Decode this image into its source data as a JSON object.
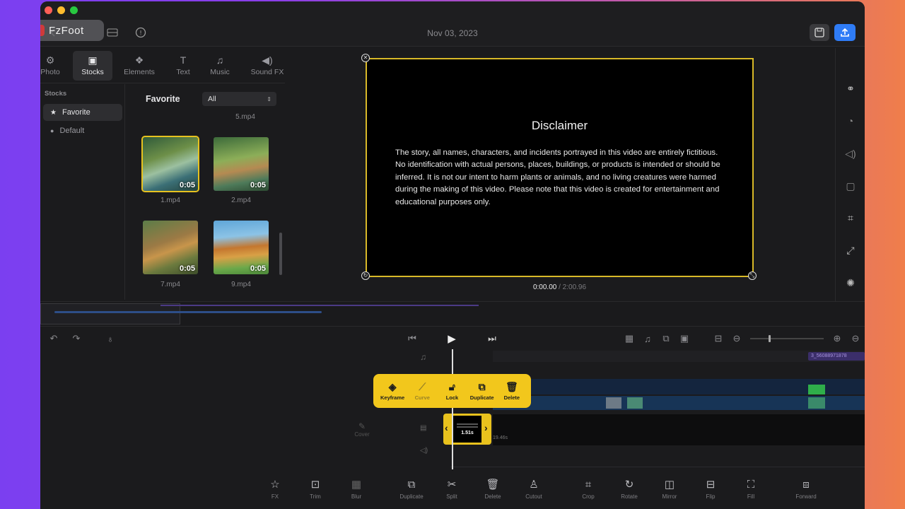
{
  "watermark": "FzFoot",
  "titlebar": {
    "date": "Nov 03, 2023"
  },
  "tabs": [
    {
      "label": "Photo",
      "icon": "photo-icon"
    },
    {
      "label": "Stocks",
      "icon": "stocks-icon"
    },
    {
      "label": "Elements",
      "icon": "elements-icon"
    },
    {
      "label": "Text",
      "icon": "text-icon"
    },
    {
      "label": "Music",
      "icon": "music-icon"
    },
    {
      "label": "Sound FX",
      "icon": "sound-fx-icon"
    }
  ],
  "sidebar": {
    "heading": "Stocks",
    "items": [
      {
        "label": "Favorite",
        "active": true
      },
      {
        "label": "Default",
        "active": false
      }
    ]
  },
  "library": {
    "title": "Favorite",
    "filter_value": "All",
    "top_caption": "5.mp4",
    "items": [
      {
        "name": "1.mp4",
        "duration": "0:05",
        "selected": true
      },
      {
        "name": "2.mp4",
        "duration": "0:05",
        "selected": false
      },
      {
        "name": "7.mp4",
        "duration": "0:05",
        "selected": false
      },
      {
        "name": "9.mp4",
        "duration": "0:05",
        "selected": false
      }
    ]
  },
  "preview": {
    "title": "Disclaimer",
    "body": "The story, all names, characters, and incidents portrayed in this video are entirely fictitious. No identification with actual persons, places, buildings, or products is intended or should be inferred. It is not our intent to harm plants or animals, and no living creatures were harmed during the making of this video. Please note that this video is created for entertainment and educational purposes only.",
    "time_current": "0:00.00",
    "time_total": " / 2:00.96"
  },
  "timeline": {
    "audio_clip_label": "3_56088971878",
    "selected_clip_duration": "1.51s",
    "clip_label": "19.46s",
    "cover_label": "Cover"
  },
  "context_menu": [
    {
      "label": "Keyframe",
      "icon": "keyframe-icon",
      "enabled": true
    },
    {
      "label": "Curve",
      "icon": "curve-icon",
      "enabled": false
    },
    {
      "label": "Lock",
      "icon": "lock-icon",
      "enabled": true
    },
    {
      "label": "Duplicate",
      "icon": "duplicate-icon",
      "enabled": true
    },
    {
      "label": "Delete",
      "icon": "delete-icon",
      "enabled": true
    }
  ],
  "bottom_tools": [
    {
      "label": "FX",
      "icon": "fx-icon"
    },
    {
      "label": "Trim",
      "icon": "trim-icon"
    },
    {
      "label": "Blur",
      "icon": "blur-icon"
    },
    {
      "label": "Duplicate",
      "icon": "duplicate-icon"
    },
    {
      "label": "Split",
      "icon": "split-icon"
    },
    {
      "label": "Delete",
      "icon": "delete-icon"
    },
    {
      "label": "Cutout",
      "icon": "cutout-icon"
    },
    {
      "label": "Crop",
      "icon": "crop-icon"
    },
    {
      "label": "Rotate",
      "icon": "rotate-icon"
    },
    {
      "label": "Mirror",
      "icon": "mirror-icon"
    },
    {
      "label": "Flip",
      "icon": "flip-icon"
    },
    {
      "label": "Fill",
      "icon": "fill-icon"
    },
    {
      "label": "Forward",
      "icon": "forward-icon"
    }
  ],
  "colors": {
    "accent": "#f2c71c",
    "upload": "#2f7cf6",
    "panel": "#1b1b1d",
    "selection": "#d9b928"
  }
}
